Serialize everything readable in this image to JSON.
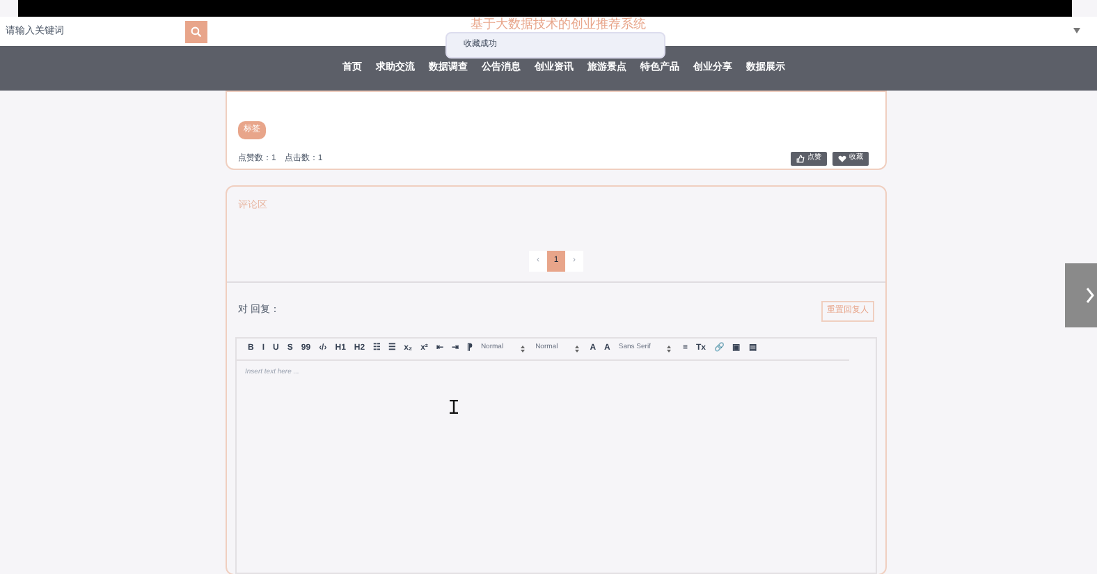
{
  "header": {
    "search": {
      "placeholder": "请输入关键词"
    },
    "title": "基于大数据技术的创业推荐系统"
  },
  "toast": {
    "message": "收藏成功"
  },
  "nav": [
    {
      "label": "首页"
    },
    {
      "label": "求助交流"
    },
    {
      "label": "数据调查"
    },
    {
      "label": "公告消息"
    },
    {
      "label": "创业资讯"
    },
    {
      "label": "旅游景点"
    },
    {
      "label": "特色产品"
    },
    {
      "label": "创业分享"
    },
    {
      "label": "数据展示"
    }
  ],
  "detail": {
    "tag": "标签",
    "stats": "点赞数：1　点击数：1",
    "buttons": [
      {
        "kind": "like",
        "label": "点赞"
      },
      {
        "kind": "favorite",
        "label": "收藏"
      }
    ]
  },
  "comments": {
    "title": "评论区",
    "pagination": {
      "prev": "‹",
      "pages": [
        {
          "label": "1",
          "selected": true
        }
      ],
      "next": "›"
    },
    "reply_label": "对 回复：",
    "reset_button": "重置回复人",
    "toolbar": [
      {
        "kind": "glyph",
        "label": "B"
      },
      {
        "kind": "glyph",
        "label": "I"
      },
      {
        "kind": "glyph",
        "label": "U"
      },
      {
        "kind": "glyph",
        "label": "S"
      },
      {
        "kind": "glyph",
        "label": "99"
      },
      {
        "kind": "glyph",
        "label": "‹/›"
      },
      {
        "kind": "glyph",
        "label": "H1"
      },
      {
        "kind": "glyph",
        "label": "H2"
      },
      {
        "kind": "glyph",
        "label": "☷"
      },
      {
        "kind": "glyph",
        "label": "☰"
      },
      {
        "kind": "glyph",
        "label": "x₂"
      },
      {
        "kind": "glyph",
        "label": "x²"
      },
      {
        "kind": "glyph",
        "label": "⇤"
      },
      {
        "kind": "glyph",
        "label": "⇥"
      },
      {
        "kind": "glyph",
        "label": "⁋"
      },
      {
        "kind": "select",
        "label": "Normal"
      },
      {
        "kind": "select",
        "label": "Normal"
      },
      {
        "kind": "glyph",
        "label": "A"
      },
      {
        "kind": "glyph",
        "label": "A"
      },
      {
        "kind": "select",
        "label": "Sans Serif"
      },
      {
        "kind": "glyph",
        "label": "≡"
      },
      {
        "kind": "glyph",
        "label": "Tx"
      },
      {
        "kind": "glyph",
        "label": "🔗"
      },
      {
        "kind": "glyph",
        "label": "▣"
      },
      {
        "kind": "glyph",
        "label": "▤"
      }
    ],
    "editor": {
      "placeholder": "Insert text here ..."
    }
  }
}
